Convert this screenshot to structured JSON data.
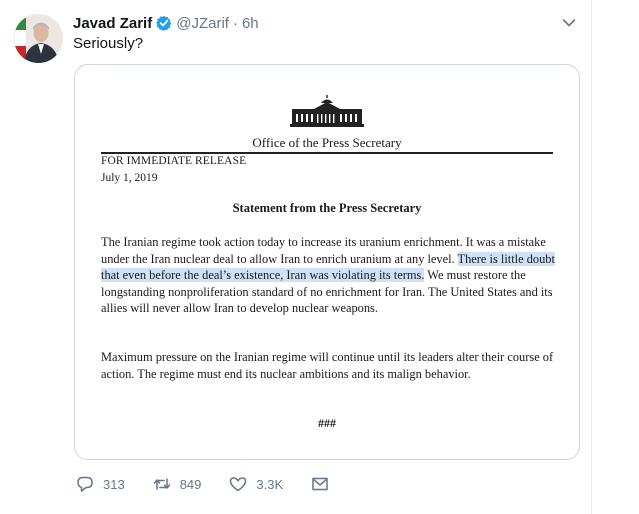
{
  "tweet": {
    "author_name": "Javad Zarif",
    "handle": "@JZarif",
    "separator": "·",
    "time": "6h",
    "text": "Seriously?"
  },
  "document": {
    "office": "Office of the Press Secretary",
    "release": "FOR IMMEDIATE RELEASE",
    "date": "July 1, 2019",
    "title": "Statement from the Press Secretary",
    "p1_a": "The Iranian regime took action today to increase its uranium enrichment.  It was a mistake under the Iran nuclear deal to allow Iran to enrich uranium at any level.  ",
    "p1_highlight": "There is little doubt that even before the deal’s existence, Iran was violating its terms.",
    "p1_b": "  We must restore the longstanding nonproliferation standard of no enrichment for Iran.  The United States and its allies will never allow Iran to develop nuclear weapons.",
    "p2": "Maximum pressure on the Iranian regime will continue until its leaders alter their course of action.  The regime must end its nuclear ambitions and its malign behavior.",
    "end_mark": "###"
  },
  "actions": {
    "replies": "313",
    "retweets": "849",
    "likes": "3.3K"
  },
  "icons": [
    "verified-badge-icon",
    "chevron-down-icon",
    "reply-icon",
    "retweet-icon",
    "like-icon",
    "message-icon",
    "white-house-icon"
  ],
  "colors": {
    "verified": "#1da1f2",
    "highlight": "#cfe0f7",
    "muted": "#657786"
  }
}
